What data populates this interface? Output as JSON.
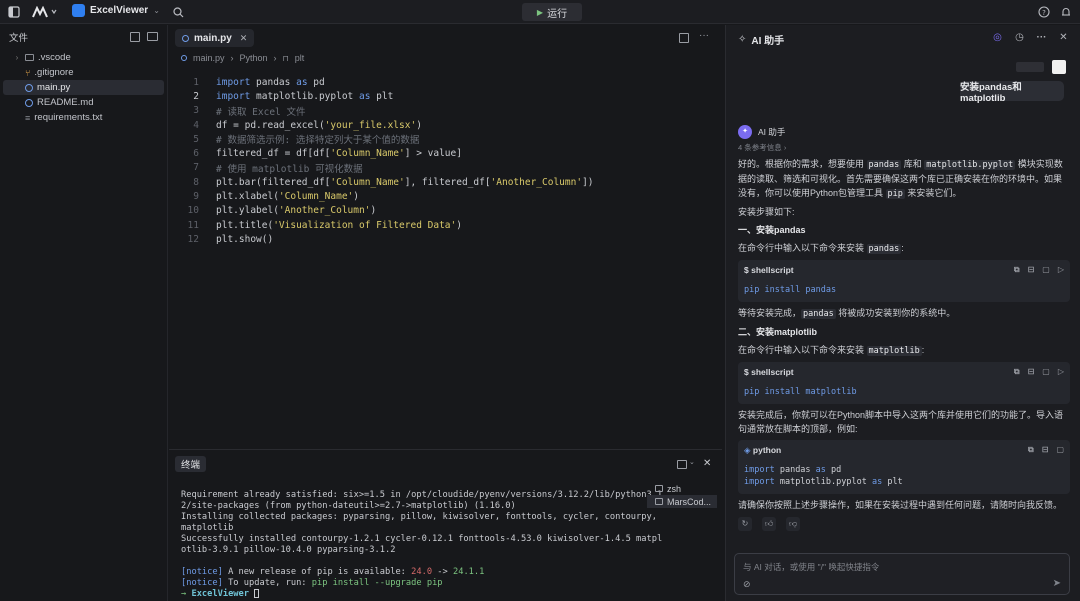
{
  "app": {
    "name": "ExcelViewer",
    "run_label": "运行"
  },
  "explorer": {
    "title": "文件",
    "items": [
      {
        "name": ".vscode",
        "kind": "folder"
      },
      {
        "name": ".gitignore",
        "kind": "git"
      },
      {
        "name": "main.py",
        "kind": "python",
        "active": true
      },
      {
        "name": "README.md",
        "kind": "info"
      },
      {
        "name": "requirements.txt",
        "kind": "text"
      }
    ]
  },
  "editor": {
    "tab": "main.py",
    "breadcrumb": [
      "main.py",
      "Python",
      "plt"
    ],
    "lines": [
      "import pandas as pd",
      "import matplotlib.pyplot as plt",
      "# 读取 Excel 文件",
      "df = pd.read_excel('your_file.xlsx')",
      "# 数据筛选示例: 选择特定列大于某个值的数据",
      "filtered_df = df[df['Column_Name'] > value]",
      "# 使用 matplotlib 可视化数据",
      "plt.bar(filtered_df['Column_Name'], filtered_df['Another_Column'])",
      "plt.xlabel('Column_Name')",
      "plt.ylabel('Another_Column')",
      "plt.title('Visualization of Filtered Data')",
      "plt.show()"
    ]
  },
  "terminal": {
    "tab": "终端",
    "output": [
      "Requirement already satisfied: six>=1.5 in /opt/cloudide/pyenv/versions/3.12.2/lib/python3.1",
      "2/site-packages (from python-dateutil>=2.7->matplotlib) (1.16.0)",
      "Installing collected packages: pyparsing, pillow, kiwisolver, fonttools, cycler, contourpy,",
      "matplotlib",
      "Successfully installed contourpy-1.2.1 cycler-0.12.1 fonttools-4.53.0 kiwisolver-1.4.5 matpl",
      "otlib-3.9.1 pillow-10.4.0 pyparsing-3.1.2",
      ""
    ],
    "notice1_pre": "A new release of pip is available: ",
    "notice_tag": "[notice]",
    "old_ver": "24.0",
    "arrow": " -> ",
    "new_ver": "24.1.1",
    "notice2_pre": "To update, run: ",
    "notice2_cmd": "pip install --upgrade pip",
    "prompt": "ExcelViewer",
    "sessions": [
      "zsh",
      "MarsCod..."
    ]
  },
  "ai": {
    "title": "AI 助手",
    "user_message": "安装pandas和matplotlib",
    "assistant_name": "AI 助手",
    "refs": "4 条参考信息",
    "intro_a": "好的。根据你的需求，想要使用 ",
    "intro_b": " 库和 ",
    "intro_c": " 模块实现数据的读取、筛选和可视化。首先需要确保这两个库已正确安装在你的环境中。如果没有，你可以使用Python包管理工具 ",
    "intro_d": " 来安装它们。",
    "code_pandas": "pandas",
    "code_pyplot": "matplotlib.pyplot",
    "code_pip": "pip",
    "steps": "安装步骤如下:",
    "s1_title": "一、安装pandas",
    "s1_text": "在命令行中输入以下命令来安装 ",
    "s1_after": "等待安装完成，",
    "s1_after2": " 将被成功安装到你的系统中。",
    "s2_title": "二、安装matplotlib",
    "s2_text": "在命令行中输入以下命令来安装 ",
    "code_matplotlib": "matplotlib",
    "shell_lang": "shellscript",
    "shell1": "pip install pandas",
    "shell2": "pip install matplotlib",
    "after_install": "安装完成后，你就可以在Python脚本中导入这两个库并使用它们的功能了。导入语句通常放在脚本的顶部，例如:",
    "py_lang": "python",
    "py1": "import pandas as pd",
    "py2": "import matplotlib.pyplot as plt",
    "closing": "请确保你按照上述步骤操作，如果在安装过程中遇到任何问题，请随时向我反馈。",
    "input_placeholder": "与 AI 对话，或使用 \"/\" 唤起快捷指令",
    "colon": ":"
  }
}
